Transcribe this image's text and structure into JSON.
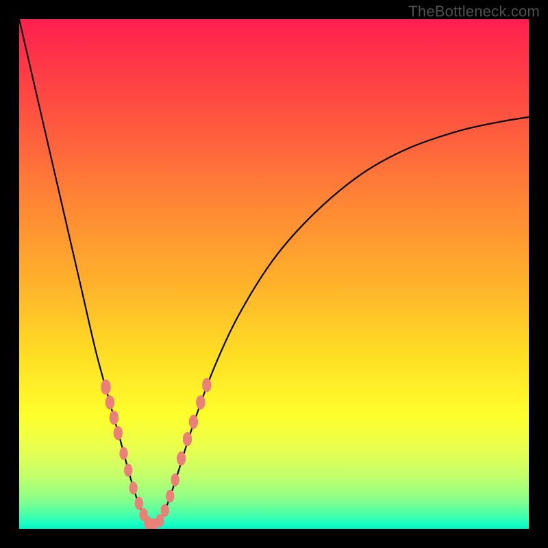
{
  "watermark": "TheBottleneck.com",
  "colors": {
    "frame_bg": "#000000",
    "watermark_text": "#4f4f4f",
    "curve_stroke": "#000000",
    "bead_fill": "#e98178",
    "gradient_top": "#ff1f4e",
    "gradient_mid_orange": "#ff8336",
    "gradient_mid_yellow": "#fdff2c",
    "gradient_bottom": "#07f0c7"
  },
  "chart_data": {
    "type": "line",
    "title": "",
    "xlabel": "",
    "ylabel": "",
    "xlim": [
      0,
      1
    ],
    "ylim": [
      0,
      1
    ],
    "annotations": [
      "TheBottleneck.com"
    ],
    "description": "Single V-shaped black curve on a vertical red→orange→yellow→green gradient. Curve starts top-left, plunges to a minimum near x≈0.25 at the bottom, then rises asymptotically toward the right edge. Salmon-colored beads cluster along the lower arms of the V.",
    "series": [
      {
        "name": "curve",
        "x": [
          0.0,
          0.03,
          0.06,
          0.09,
          0.12,
          0.15,
          0.175,
          0.2,
          0.215,
          0.23,
          0.245,
          0.258,
          0.275,
          0.29,
          0.31,
          0.34,
          0.38,
          0.43,
          0.5,
          0.58,
          0.67,
          0.76,
          0.86,
          0.94,
          1.0
        ],
        "y": [
          1.0,
          0.87,
          0.74,
          0.61,
          0.48,
          0.35,
          0.258,
          0.168,
          0.112,
          0.062,
          0.026,
          0.008,
          0.015,
          0.046,
          0.105,
          0.2,
          0.31,
          0.418,
          0.53,
          0.62,
          0.695,
          0.745,
          0.78,
          0.798,
          0.808
        ]
      }
    ],
    "beads": [
      {
        "x": 0.17,
        "y": 0.278,
        "r": 0.013
      },
      {
        "x": 0.178,
        "y": 0.248,
        "r": 0.012
      },
      {
        "x": 0.186,
        "y": 0.218,
        "r": 0.012
      },
      {
        "x": 0.194,
        "y": 0.188,
        "r": 0.012
      },
      {
        "x": 0.205,
        "y": 0.148,
        "r": 0.011
      },
      {
        "x": 0.214,
        "y": 0.115,
        "r": 0.011
      },
      {
        "x": 0.224,
        "y": 0.08,
        "r": 0.011
      },
      {
        "x": 0.235,
        "y": 0.05,
        "r": 0.011
      },
      {
        "x": 0.244,
        "y": 0.028,
        "r": 0.011
      },
      {
        "x": 0.253,
        "y": 0.012,
        "r": 0.011
      },
      {
        "x": 0.264,
        "y": 0.008,
        "r": 0.011
      },
      {
        "x": 0.276,
        "y": 0.016,
        "r": 0.011
      },
      {
        "x": 0.286,
        "y": 0.036,
        "r": 0.011
      },
      {
        "x": 0.296,
        "y": 0.064,
        "r": 0.011
      },
      {
        "x": 0.306,
        "y": 0.096,
        "r": 0.011
      },
      {
        "x": 0.318,
        "y": 0.138,
        "r": 0.012
      },
      {
        "x": 0.33,
        "y": 0.176,
        "r": 0.012
      },
      {
        "x": 0.342,
        "y": 0.21,
        "r": 0.012
      },
      {
        "x": 0.356,
        "y": 0.248,
        "r": 0.012
      },
      {
        "x": 0.368,
        "y": 0.282,
        "r": 0.012
      }
    ]
  }
}
